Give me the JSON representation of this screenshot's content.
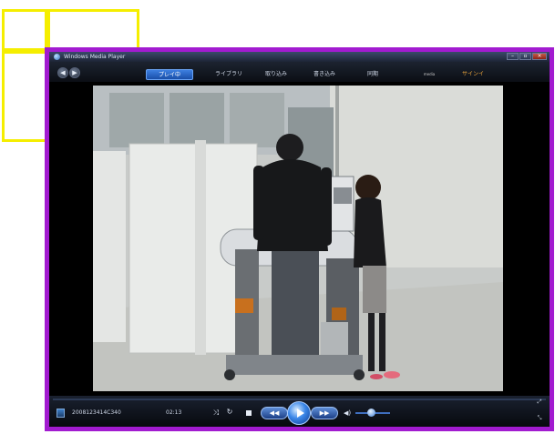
{
  "window": {
    "title": "Windows Media Player",
    "min_label": "–",
    "max_label": "▫",
    "close_label": "×"
  },
  "nav": {
    "back_label": "◀",
    "forward_label": "▶",
    "tabs": [
      {
        "label": "プレイ中"
      },
      {
        "label": "ライブラリ"
      },
      {
        "label": "取り込み"
      },
      {
        "label": "書き込み"
      },
      {
        "label": "同期"
      },
      {
        "label": "media"
      },
      {
        "label": "サインイン"
      }
    ]
  },
  "player": {
    "media_title": "2008123414C340",
    "elapsed_time": "02:13",
    "shuffle_label": "⤨",
    "repeat_label": "↻",
    "prev_label": "◀◀",
    "next_label": "▶▶",
    "mute_label": "◀)",
    "full_mode_label": "⤢",
    "fullscreen_label": "⤡"
  },
  "colors": {
    "annotation_yellow": "#f5ee00",
    "annotation_purple": "#a21bd0",
    "accent_blue": "#3a86e8"
  },
  "icons": {
    "app": "wmp-icon",
    "shuffle": "shuffle-icon",
    "repeat": "repeat-icon",
    "stop": "stop-icon",
    "play": "play-icon",
    "volume": "speaker-icon"
  }
}
